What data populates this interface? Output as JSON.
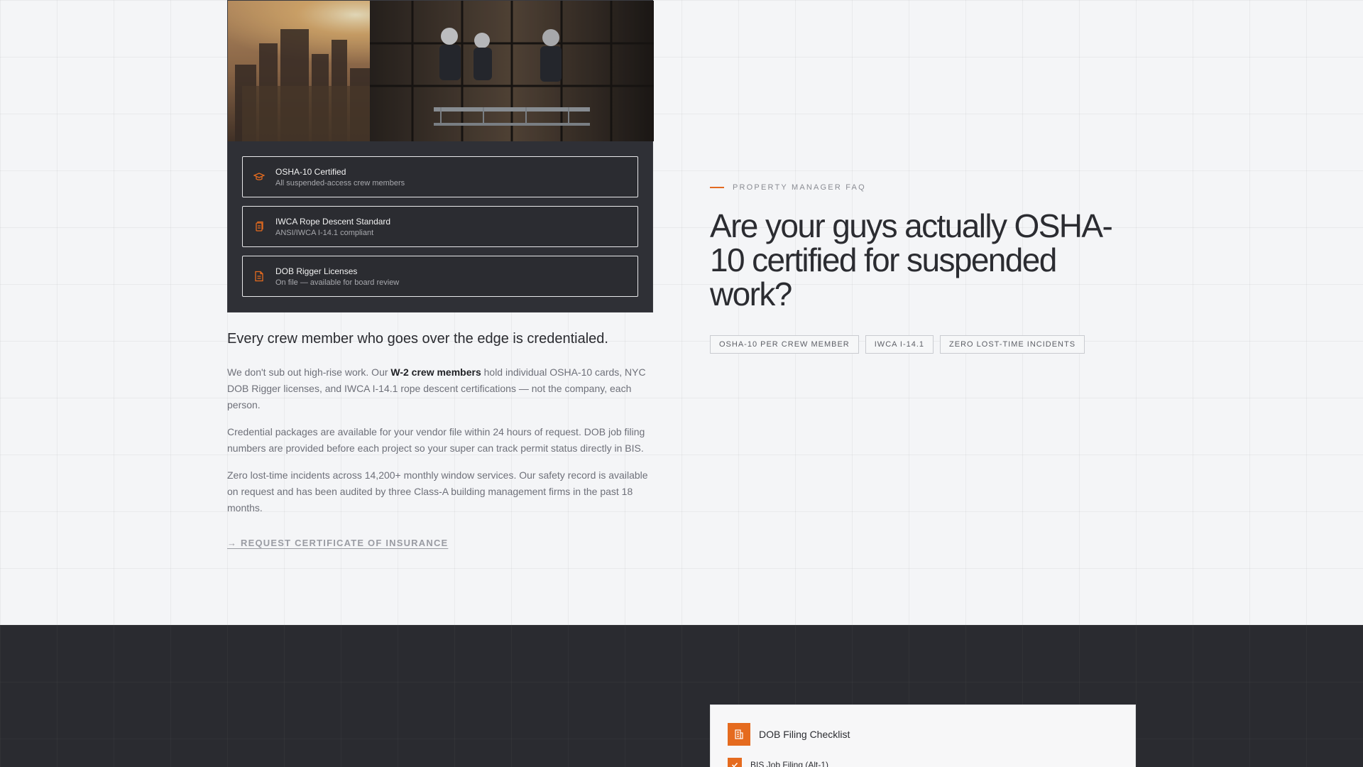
{
  "colors": {
    "accent": "#e56b1f",
    "dark": "#2a2b30",
    "page": "#f4f5f7"
  },
  "credentials": [
    {
      "icon": "graduation-cap-icon",
      "title": "OSHA-10 Certified",
      "subtitle": "All suspended-access crew members"
    },
    {
      "icon": "documents-icon",
      "title": "IWCA Rope Descent Standard",
      "subtitle": "ANSI/IWCA I-14.1 compliant"
    },
    {
      "icon": "file-icon",
      "title": "DOB Rigger Licenses",
      "subtitle": "On file — available for board review"
    }
  ],
  "copy": {
    "lead": "Every crew member who goes over the edge is credentialed.",
    "p1_pre": "We don't sub out high-rise work. Our ",
    "p1_bold": "W-2 crew members",
    "p1_post": " hold individual OSHA-10 cards, NYC DOB Rigger licenses, and IWCA I-14.1 rope descent certifications — not the company, each person.",
    "p2": "Credential packages are available for your vendor file within 24 hours of request. DOB job filing numbers are provided before each project so your super can track permit status directly in BIS.",
    "p3": "Zero lost-time incidents across 14,200+ monthly window services. Our safety record is available on request and has been audited by three Class-A building management firms in the past 18 months.",
    "link": "→ REQUEST CERTIFICATE OF INSURANCE"
  },
  "faq": {
    "eyebrow": "PROPERTY MANAGER FAQ",
    "title": "Are your guys actually OSHA-10 certified for suspended work?",
    "tags": [
      "OSHA-10 PER CREW MEMBER",
      "IWCA I-14.1",
      "ZERO LOST-TIME INCIDENTS"
    ]
  },
  "checklist": {
    "icon": "building-icon",
    "title": "DOB Filing Checklist",
    "items": [
      {
        "label": "BIS Job Filing (Alt-1)",
        "checked": true
      }
    ]
  }
}
